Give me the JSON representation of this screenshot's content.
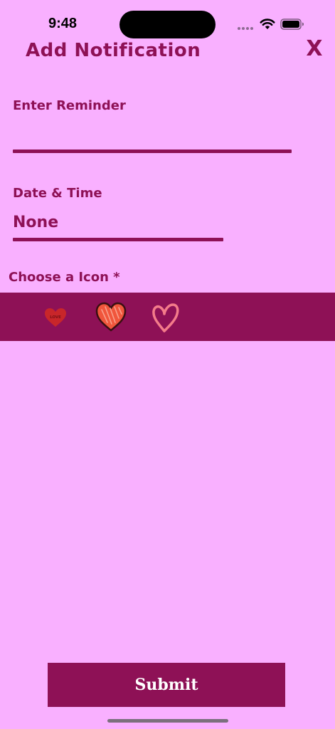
{
  "status_bar": {
    "time": "9:48"
  },
  "header": {
    "title": "Add Notification",
    "close_label": "X"
  },
  "form": {
    "reminder_label": "Enter Reminder",
    "reminder_value": "",
    "date_label": "Date & Time",
    "date_value": "None",
    "icon_label": "Choose a Icon *",
    "icons": [
      {
        "name": "love-heart-icon",
        "badge_text": "LOVE",
        "color": "#C8262A"
      },
      {
        "name": "scribble-heart-icon",
        "color": "#F0563C"
      },
      {
        "name": "outline-heart-icon",
        "color": "#F47C8A"
      }
    ]
  },
  "submit_label": "Submit",
  "colors": {
    "background": "#F9B0FF",
    "accent": "#8E1156"
  }
}
